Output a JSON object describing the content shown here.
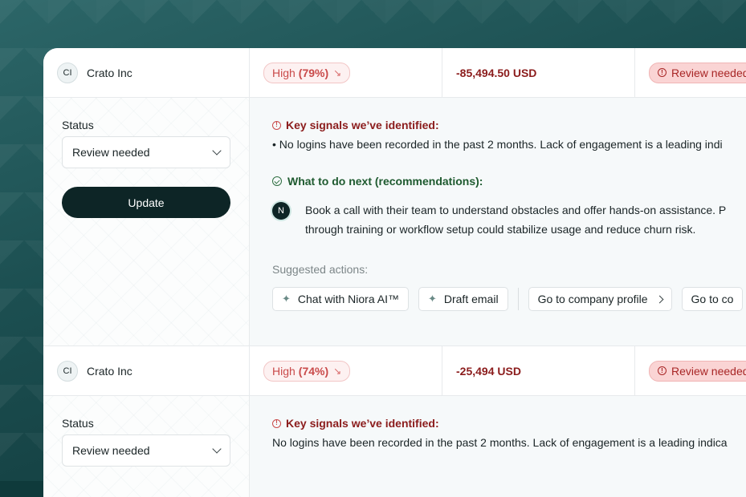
{
  "rows": [
    {
      "avatar": "CI",
      "company": "Crato Inc",
      "risk_level": "High",
      "risk_pct": "(79%)",
      "amount": "-85,494.50 USD",
      "status": "Review needed",
      "detail": {
        "status_label": "Status",
        "status_value": "Review needed",
        "update_label": "Update",
        "signals_title": "Key signals we’ve identified:",
        "signal_text": "• No logins have been recorded in the past 2 months. Lack of engagement is a leading indi",
        "next_title": "What to do next (recommendations):",
        "rec_avatar": "N",
        "rec_line1": "Book a call with their team to understand obstacles and offer hands-on assistance. P",
        "rec_line2": "through training or workflow setup could stabilize usage and reduce churn risk.",
        "suggested_label": "Suggested actions:",
        "actions": {
          "chat": "Chat with Niora AI™",
          "draft": "Draft email",
          "profile": "Go to company profile",
          "more": "Go to co"
        }
      }
    },
    {
      "avatar": "CI",
      "company": "Crato Inc",
      "risk_level": "High",
      "risk_pct": "(74%)",
      "amount": "-25,494 USD",
      "status": "Review needed",
      "detail": {
        "status_label": "Status",
        "status_value": "Review needed",
        "signals_title": "Key signals we’ve identified:",
        "signal_text": "No logins have been recorded in the past 2 months. Lack of engagement is a leading indica"
      }
    }
  ],
  "colors": {
    "accent_dark": "#0d2526",
    "risk_red": "#c94a4a",
    "amount_red": "#8b1c1c",
    "rec_green": "#1e5a2f"
  }
}
